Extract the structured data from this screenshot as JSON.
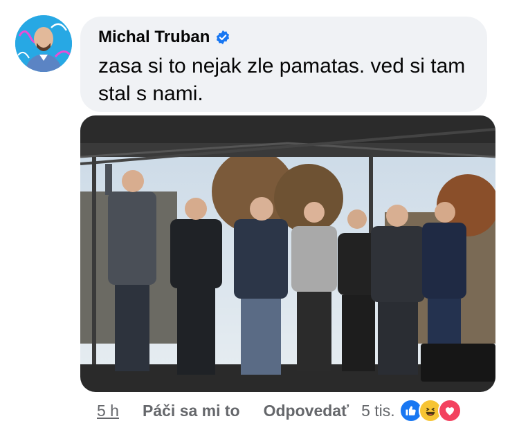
{
  "comment": {
    "author": "Michal Truban",
    "text": "zasa si to nejak zle pamatas. ved si tam stal s nami.",
    "verified_icon": "verified-badge-icon",
    "accent": "#1877f2"
  },
  "actions": {
    "time": "5 h",
    "like_label": "Páči sa mi to",
    "reply_label": "Odpovedať",
    "reaction_count": "5 tis.",
    "reactions": [
      "like-icon",
      "haha-icon",
      "love-icon"
    ]
  }
}
